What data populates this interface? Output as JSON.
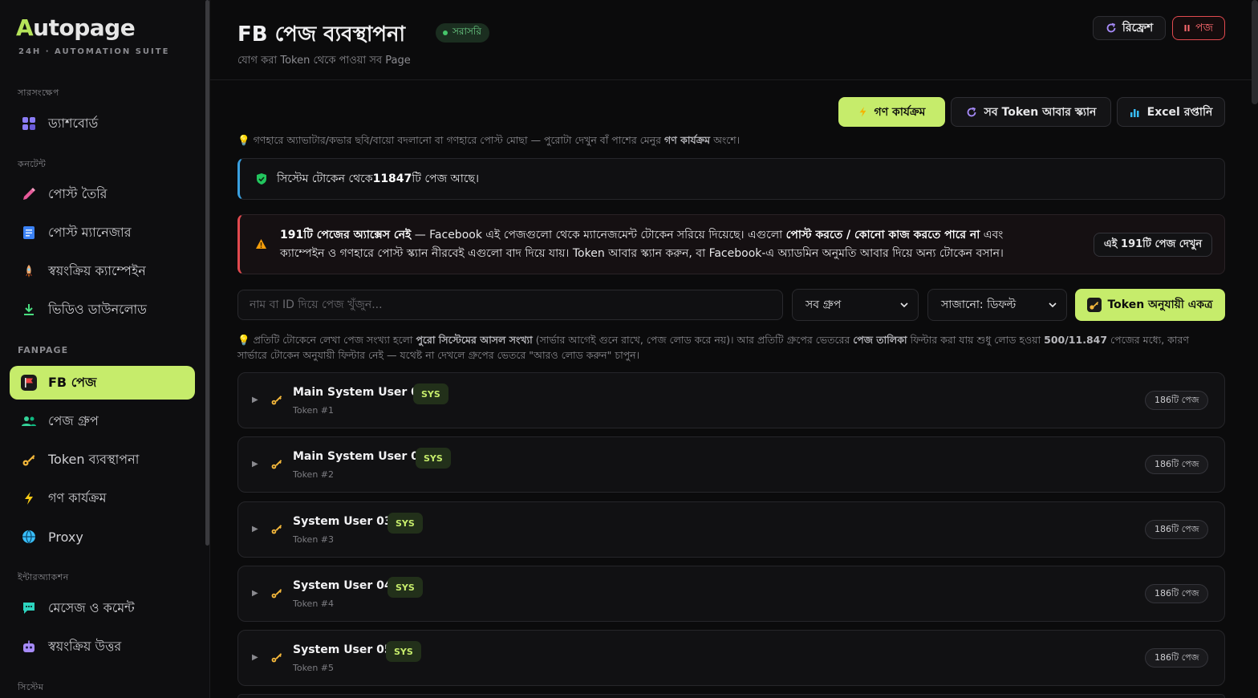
{
  "app": {
    "logo_first": "A",
    "logo_rest": "utopage",
    "tagline": "24H · AUTOMATION SUITE"
  },
  "sidebar": {
    "sections": [
      {
        "label": "সারসংক্ষেপ"
      },
      {
        "label": "কনটেন্ট"
      },
      {
        "label": "FANPAGE"
      },
      {
        "label": "ইন্টারঅ্যাকশন"
      },
      {
        "label": "সিস্টেম"
      }
    ],
    "items": [
      {
        "label": "ড্যাশবোর্ড",
        "icon": "grid-icon"
      },
      {
        "label": "পোস্ট তৈরি",
        "icon": "pencil-icon"
      },
      {
        "label": "পোস্ট ম্যানেজার",
        "icon": "document-icon"
      },
      {
        "label": "স্বয়ংক্রিয় ক্যাম্পেইন",
        "icon": "rocket-icon"
      },
      {
        "label": "ভিডিও ডাউনলোড",
        "icon": "download-icon"
      },
      {
        "label": "FB পেজ",
        "icon": "flag-icon"
      },
      {
        "label": "পেজ গ্রুপ",
        "icon": "users-icon"
      },
      {
        "label": "Token ব্যবস্থাপনা",
        "icon": "key-icon"
      },
      {
        "label": "গণ কার্যক্রম",
        "icon": "bolt-icon"
      },
      {
        "label": "Proxy",
        "icon": "globe-icon"
      },
      {
        "label": "মেসেজ ও কমেন্ট",
        "icon": "chat-icon"
      },
      {
        "label": "স্বয়ংক্রিয় উত্তর",
        "icon": "robot-icon"
      }
    ]
  },
  "header": {
    "title": "FB পেজ ব্যবস্থাপনা",
    "live_badge": "সরাসরি",
    "subtitle": "যোগ করা Token থেকে পাওয়া সব Page",
    "refresh_label": "রিফ্রেশ",
    "pause_label": "পজ"
  },
  "toolbar": {
    "bulk_label": "গণ কার্যক্রম",
    "rescan_label": "সব Token আবার স্ক্যান",
    "excel_label": "Excel রপ্তানি"
  },
  "hint1": {
    "text_a": "গণহারে অ্যাভাটার/কভার ছবি/বায়ো বদলানো বা গণহারে পোস্ট মোছা — পুরোটা দেখুন বাঁ পাশের মেনুর ",
    "text_b": "গণ কার্যক্রম",
    "text_c": " অংশে।"
  },
  "info": {
    "text_a": "সিস্টেম টোকেন থেকে ",
    "text_b": "11847",
    "text_c": "টি পেজ আছে।"
  },
  "warning": {
    "p1": "191টি পেজের অ্যাক্সেস নেই",
    "p2": " — Facebook এই পেজগুলো থেকে ম্যানেজমেন্ট টোকেন সরিয়ে দিয়েছে। এগুলো ",
    "p3": "পোস্ট করতে / কোনো কাজ করতে পারে না",
    "p4": " এবং ক্যাম্পেইন ও গণহারে পোস্ট স্ক্যান নীরবেই এগুলো বাদ দিয়ে যায়। Token আবার স্ক্যান করুন, বা Facebook-এ অ্যাডমিন অনুমতি আবার দিয়ে অন্য টোকেন বসান।",
    "button": "এই 191টি পেজ দেখুন"
  },
  "filters": {
    "search_placeholder": "নাম বা ID দিয়ে পেজ খুঁজুন...",
    "group_select": "সব গ্রুপ",
    "sort_select": "সাজানো: ডিফল্ট",
    "group_button": "Token অনুযায়ী একত্র"
  },
  "hint2": {
    "a": "প্রতিটি টোকেনে লেখা পেজ সংখ্যা হলো ",
    "b": "পুরো সিস্টেমের আসল সংখ্যা",
    "c": " (সার্ভার আগেই গুনে রাখে, পেজ লোড করে নয়)। আর প্রতিটি গ্রুপের ভেতরের ",
    "d": "পেজ তালিকা",
    "e": " ফিল্টার করা যায় শুধু লোড হওয়া ",
    "f": "500/11.847",
    "g": " পেজের মধ্যে, কারণ সার্ভারে টোকেন অনুযায়ী ফিল্টার নেই — যথেষ্ট না দেখলে গ্রুপের ভেতরে \"আরও লোড করুন\" চাপুন।"
  },
  "tokens": [
    {
      "name": "Main System User 01",
      "badge": "SYS",
      "sub": "Token #1",
      "count": "186টি পেজ"
    },
    {
      "name": "Main System User 02",
      "badge": "SYS",
      "sub": "Token #2",
      "count": "186টি পেজ"
    },
    {
      "name": "System User 03",
      "badge": "SYS",
      "sub": "Token #3",
      "count": "186টি পেজ"
    },
    {
      "name": "System User 04",
      "badge": "SYS",
      "sub": "Token #4",
      "count": "186টি পেজ"
    },
    {
      "name": "System User 05",
      "badge": "SYS",
      "sub": "Token #5",
      "count": "186টি পেজ"
    }
  ],
  "colors": {
    "accent": "#c6ec6b",
    "danger": "#e24a4f",
    "info": "#3aa0e0",
    "live": "#46c56a"
  }
}
